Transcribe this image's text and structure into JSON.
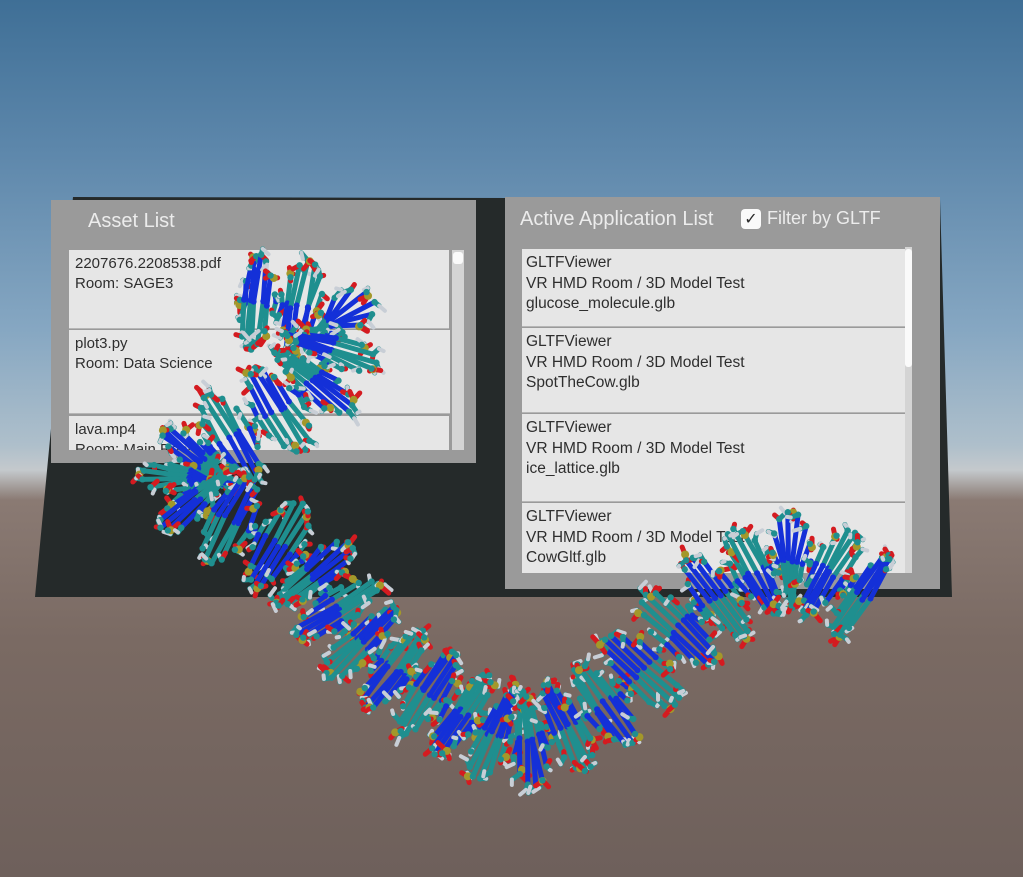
{
  "asset_panel": {
    "title": "Asset List",
    "items": [
      {
        "name": "2207676.2208538.pdf",
        "room": "Room: SAGE3"
      },
      {
        "name": "plot3.py",
        "room": "Room: Data Science"
      },
      {
        "name": "lava.mp4",
        "room": "Room: Main Room"
      }
    ]
  },
  "app_panel": {
    "title": "Active Application List",
    "filter_label": "Filter by GLTF",
    "filter_checked": true,
    "items": [
      {
        "app": "GLTFViewer",
        "room": "VR HMD Room / 3D Model Test",
        "file": "glucose_molecule.glb"
      },
      {
        "app": "GLTFViewer",
        "room": "VR HMD Room / 3D Model Test",
        "file": "SpotTheCow.glb"
      },
      {
        "app": "GLTFViewer",
        "room": "VR HMD Room / 3D Model Test",
        "file": "ice_lattice.glb"
      },
      {
        "app": "GLTFViewer",
        "room": "VR HMD Room / 3D Model Test",
        "file": "CowGltf.glb"
      }
    ]
  },
  "scene": {
    "model_icon": "dna-molecule-model",
    "colors": {
      "carbon": "#1f8f8f",
      "nitrogen": "#1430d8",
      "oxygen": "#d41b20",
      "phosphorus": "#a3982a",
      "hydrogen": "#c8ced6"
    }
  }
}
